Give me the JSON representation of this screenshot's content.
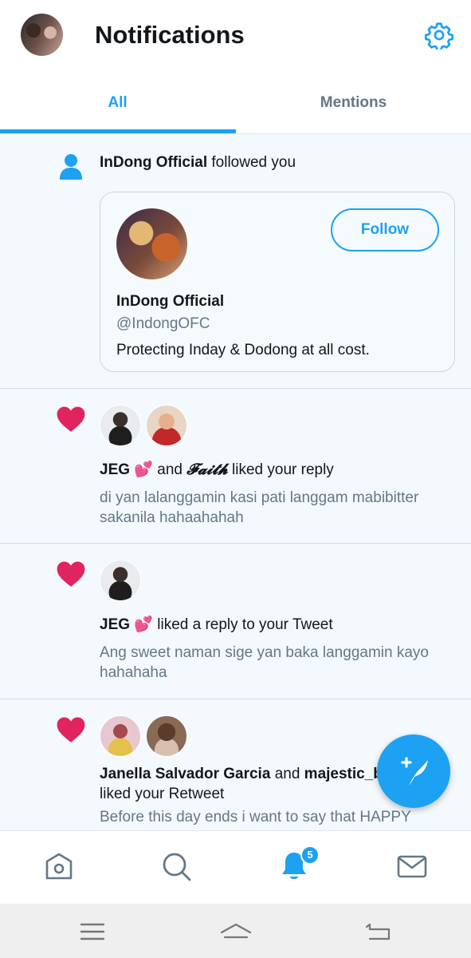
{
  "header": {
    "title": "Notifications",
    "avatar_icon": "profile-avatar",
    "settings_icon": "gear-icon"
  },
  "tabs": [
    {
      "label": "All",
      "active": true
    },
    {
      "label": "Mentions",
      "active": false
    }
  ],
  "notifications": [
    {
      "type": "follow",
      "icon": "person-icon",
      "actor": "InDong Official",
      "action": "followed you",
      "card": {
        "name": "InDong Official",
        "handle": "@IndongOFC",
        "bio": "Protecting Inday & Dodong at all cost.",
        "follow_label": "Follow"
      }
    },
    {
      "type": "like",
      "icon": "heart-icon",
      "actor1": "JEG",
      "emoji": "💕",
      "connector": "and",
      "actor2": "𝓕𝓪𝓲𝓽𝓱",
      "action": "liked your reply",
      "text_line1": "di yan lalanggamin kasi pati langgam mabibitter",
      "text_line2": "sakanila hahaahahah"
    },
    {
      "type": "like",
      "icon": "heart-icon",
      "actor1": "JEG",
      "emoji": "💕",
      "action": "liked a reply to your Tweet",
      "text_line1": "Ang sweet naman sige yan baka langgamin kayo",
      "text_line2": "hahahaha"
    },
    {
      "type": "like",
      "icon": "heart-icon",
      "actor1": "Janella Salvador Garcia",
      "connector": "and",
      "actor2": "majestic_b",
      "action": "liked your Retweet",
      "text_line1": "Before this day ends i want to say that HAPPY"
    }
  ],
  "fab": {
    "icon": "compose-tweet-icon"
  },
  "bottom_nav": {
    "items": [
      "home-icon",
      "search-icon",
      "notifications-bell-icon",
      "messages-icon"
    ],
    "badge_count": "5",
    "active": "notifications-bell-icon"
  },
  "system_nav": [
    "menu-icon",
    "home-icon",
    "back-icon"
  ],
  "colors": {
    "accent": "#1da1f2",
    "heart": "#e0245e",
    "text": "#14171a",
    "muted": "#657786"
  }
}
